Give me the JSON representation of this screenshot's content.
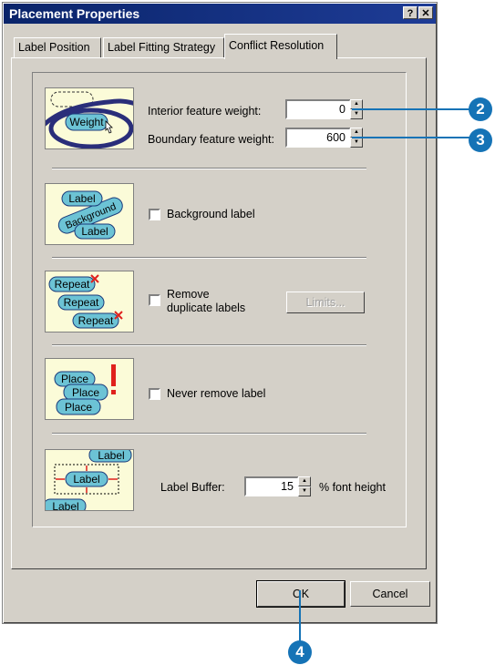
{
  "window": {
    "title": "Placement Properties",
    "help_button": "?",
    "close_button": "✕"
  },
  "tabs": [
    {
      "label": "Label Position"
    },
    {
      "label": "Label Fitting Strategy"
    },
    {
      "label": "Conflict Resolution"
    }
  ],
  "active_tab": "Conflict Resolution",
  "weights": {
    "interior_label": "Interior feature weight:",
    "interior_value": "0",
    "boundary_label": "Boundary feature weight:",
    "boundary_value": "600",
    "icon_text": "Weight"
  },
  "background": {
    "checkbox_label": "Background label",
    "checked": false,
    "icon_texts": [
      "Label",
      "Background",
      "Label"
    ]
  },
  "duplicates": {
    "checkbox_label_line1": "Remove",
    "checkbox_label_line2": "duplicate labels",
    "checked": false,
    "limits_button": "Limits...",
    "limits_enabled": false,
    "icon_texts": [
      "Repeat",
      "Repeat",
      "Repeat"
    ]
  },
  "never_remove": {
    "checkbox_label": "Never remove label",
    "checked": false,
    "icon_texts": [
      "Place",
      "Place",
      "Place"
    ]
  },
  "buffer": {
    "label": "Label Buffer:",
    "value": "15",
    "unit": "% font height",
    "icon_texts": [
      "Label",
      "Label",
      "Label"
    ]
  },
  "buttons": {
    "ok": "OK",
    "cancel": "Cancel"
  },
  "callouts": [
    "2",
    "3",
    "4"
  ],
  "colors": {
    "title_bar": "#0a246a",
    "dialog_face": "#d4d0c8",
    "icon_background": "#fbfbd8",
    "label_fill": "#6cc3d5",
    "callout": "#1573b6",
    "conflict_mark": "#e0201c"
  }
}
